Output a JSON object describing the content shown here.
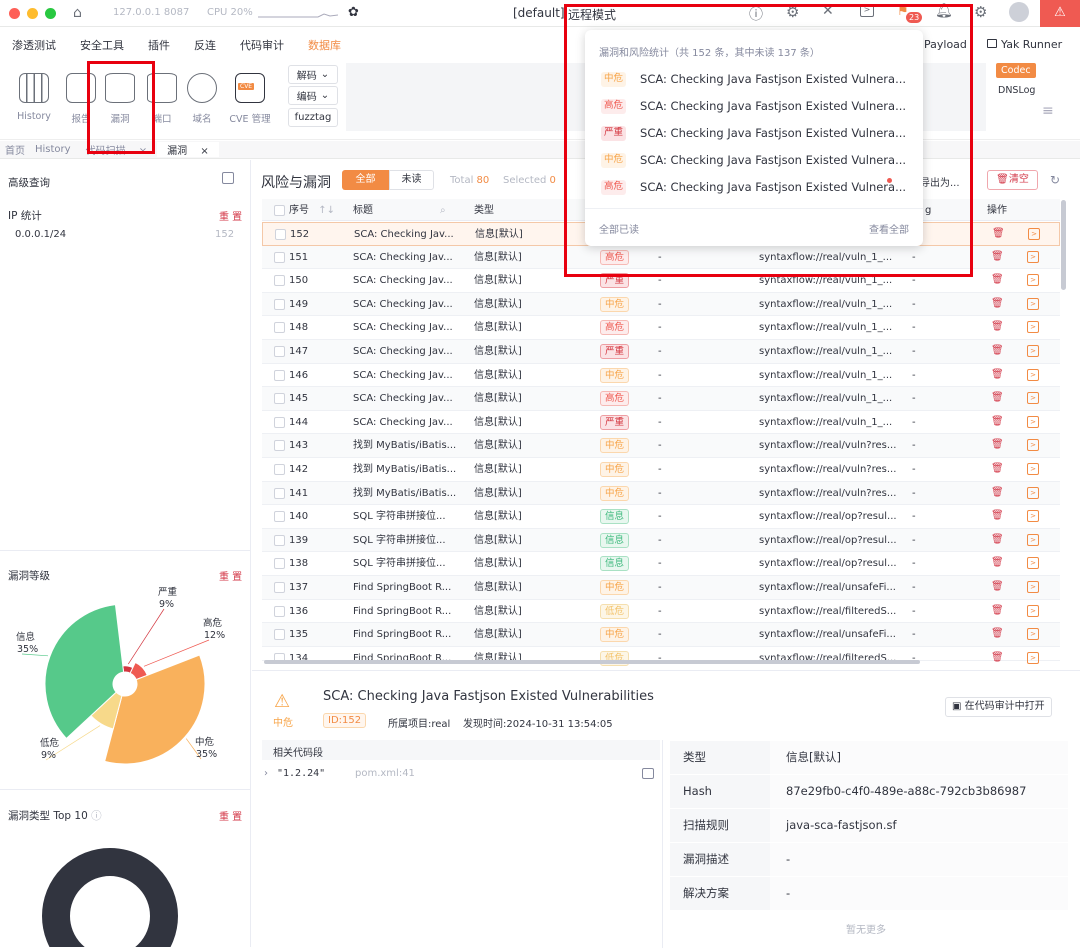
{
  "titlebar": {
    "host": "127.0.0.1 8087",
    "cpu": "CPU 20%",
    "project": "[default]",
    "mode": "远程模式",
    "notif_badge": "23"
  },
  "menu": [
    "渗透测试",
    "安全工具",
    "插件",
    "反连",
    "代码审计",
    "数据库"
  ],
  "menu_right": {
    "payload": "Payload",
    "yak_runner": "Yak Runner"
  },
  "toolbar": {
    "tools": [
      "History",
      "报告",
      "漏洞",
      "端口",
      "域名",
      "CVE 管理"
    ],
    "cve_badge": "CVE",
    "decode": "解码",
    "encode": "编码",
    "fuzztag": "fuzztag",
    "codec": "Codec",
    "dnslog": "DNSLog"
  },
  "tabs": [
    "首页",
    "History",
    "代码扫描",
    "漏洞"
  ],
  "sidebar": {
    "advanced_query": "高级查询",
    "ip_stats": "IP 统计",
    "reset": "重 置",
    "ip_rows": [
      {
        "ip": "0.0.0.1/24",
        "count": "152"
      }
    ],
    "level_title": "漏洞等级",
    "type_title": "漏洞类型 Top 10"
  },
  "chart_data": [
    {
      "type": "pie",
      "title": "漏洞等级",
      "labels": [
        "严重",
        "高危",
        "中危",
        "低危",
        "信息"
      ],
      "values": [
        9,
        12,
        35,
        9,
        35
      ],
      "display": [
        "9%",
        "12%",
        "35%",
        "9%",
        "35%"
      ],
      "colors": [
        "#d3363f",
        "#ef5a52",
        "#f9b15c",
        "#f7d98a",
        "#56c98a"
      ]
    },
    {
      "type": "pie",
      "title": "漏洞类型 Top 10",
      "labels": [],
      "values": [
        100
      ],
      "colors": [
        "#31343f"
      ]
    }
  ],
  "main": {
    "title": "风险与漏洞",
    "filter_all": "全部",
    "filter_unread": "未读",
    "total_label": "Total",
    "total": "80",
    "selected_label": "Selected",
    "selected": "0",
    "export": "导出为...",
    "clear": "清空",
    "columns": [
      "序号",
      "标题",
      "类型",
      "",
      "",
      "",
      "g",
      "操作"
    ],
    "rows": [
      {
        "id": "152",
        "title": "SCA: Checking Jav...",
        "type": "信息[默认]",
        "level": "",
        "lc": "",
        "ip": "",
        "path": "",
        "x": ""
      },
      {
        "id": "151",
        "title": "SCA: Checking Jav...",
        "type": "信息[默认]",
        "level": "高危",
        "lc": "t-high",
        "ip": "-",
        "path": "syntaxflow://real/vuln_1_...",
        "x": "-"
      },
      {
        "id": "150",
        "title": "SCA: Checking Jav...",
        "type": "信息[默认]",
        "level": "严重",
        "lc": "t-sev",
        "ip": "-",
        "path": "syntaxflow://real/vuln_1_...",
        "x": "-"
      },
      {
        "id": "149",
        "title": "SCA: Checking Jav...",
        "type": "信息[默认]",
        "level": "中危",
        "lc": "t-mid",
        "ip": "-",
        "path": "syntaxflow://real/vuln_1_...",
        "x": "-"
      },
      {
        "id": "148",
        "title": "SCA: Checking Jav...",
        "type": "信息[默认]",
        "level": "高危",
        "lc": "t-high",
        "ip": "-",
        "path": "syntaxflow://real/vuln_1_...",
        "x": "-"
      },
      {
        "id": "147",
        "title": "SCA: Checking Jav...",
        "type": "信息[默认]",
        "level": "严重",
        "lc": "t-sev",
        "ip": "-",
        "path": "syntaxflow://real/vuln_1_...",
        "x": "-"
      },
      {
        "id": "146",
        "title": "SCA: Checking Jav...",
        "type": "信息[默认]",
        "level": "中危",
        "lc": "t-mid",
        "ip": "-",
        "path": "syntaxflow://real/vuln_1_...",
        "x": "-"
      },
      {
        "id": "145",
        "title": "SCA: Checking Jav...",
        "type": "信息[默认]",
        "level": "高危",
        "lc": "t-high",
        "ip": "-",
        "path": "syntaxflow://real/vuln_1_...",
        "x": "-"
      },
      {
        "id": "144",
        "title": "SCA: Checking Jav...",
        "type": "信息[默认]",
        "level": "严重",
        "lc": "t-sev",
        "ip": "-",
        "path": "syntaxflow://real/vuln_1_...",
        "x": "-"
      },
      {
        "id": "143",
        "title": "找到 MyBatis/iBatis...",
        "type": "信息[默认]",
        "level": "中危",
        "lc": "t-mid",
        "ip": "-",
        "path": "syntaxflow://real/vuln?res...",
        "x": "-"
      },
      {
        "id": "142",
        "title": "找到 MyBatis/iBatis...",
        "type": "信息[默认]",
        "level": "中危",
        "lc": "t-mid",
        "ip": "-",
        "path": "syntaxflow://real/vuln?res...",
        "x": "-"
      },
      {
        "id": "141",
        "title": "找到 MyBatis/iBatis...",
        "type": "信息[默认]",
        "level": "中危",
        "lc": "t-mid",
        "ip": "-",
        "path": "syntaxflow://real/vuln?res...",
        "x": "-"
      },
      {
        "id": "140",
        "title": "SQL 字符串拼接位...",
        "type": "信息[默认]",
        "level": "信息",
        "lc": "t-info",
        "ip": "-",
        "path": "syntaxflow://real/op?resul...",
        "x": "-"
      },
      {
        "id": "139",
        "title": "SQL 字符串拼接位...",
        "type": "信息[默认]",
        "level": "信息",
        "lc": "t-info",
        "ip": "-",
        "path": "syntaxflow://real/op?resul...",
        "x": "-"
      },
      {
        "id": "138",
        "title": "SQL 字符串拼接位...",
        "type": "信息[默认]",
        "level": "信息",
        "lc": "t-info",
        "ip": "-",
        "path": "syntaxflow://real/op?resul...",
        "x": "-"
      },
      {
        "id": "137",
        "title": "Find SpringBoot R...",
        "type": "信息[默认]",
        "level": "中危",
        "lc": "t-mid",
        "ip": "-",
        "path": "syntaxflow://real/unsafeFi...",
        "x": "-"
      },
      {
        "id": "136",
        "title": "Find SpringBoot R...",
        "type": "信息[默认]",
        "level": "低危",
        "lc": "t-low",
        "ip": "-",
        "path": "syntaxflow://real/filteredS...",
        "x": "-"
      },
      {
        "id": "135",
        "title": "Find SpringBoot R...",
        "type": "信息[默认]",
        "level": "中危",
        "lc": "t-mid",
        "ip": "-",
        "path": "syntaxflow://real/unsafeFi...",
        "x": "-"
      },
      {
        "id": "134",
        "title": "Find SpringBoot R...",
        "type": "信息[默认]",
        "level": "低危",
        "lc": "t-low",
        "ip": "-",
        "path": "syntaxflow://real/filteredS...",
        "x": "-"
      }
    ]
  },
  "notifications": {
    "summary": "漏洞和风险统计（共 152 条，其中未读 137 条）",
    "items": [
      {
        "level": "中危",
        "lc": "t-mid",
        "text": "SCA: Checking Java Fastjson Existed Vulnera..."
      },
      {
        "level": "高危",
        "lc": "t-high",
        "text": "SCA: Checking Java Fastjson Existed Vulnera..."
      },
      {
        "level": "严重",
        "lc": "t-sev",
        "text": "SCA: Checking Java Fastjson Existed Vulnera..."
      },
      {
        "level": "中危",
        "lc": "t-mid",
        "text": "SCA: Checking Java Fastjson Existed Vulnera..."
      },
      {
        "level": "高危",
        "lc": "t-high",
        "text": "SCA: Checking Java Fastjson Existed Vulnera..."
      }
    ],
    "mark_all_read": "全部已读",
    "view_all": "查看全部"
  },
  "detail": {
    "level": "中危",
    "title": "SCA: Checking Java Fastjson Existed Vulnerabilities",
    "id": "ID:152",
    "project": "所属项目:real",
    "time": "发现时间:2024-10-31 13:54:05",
    "open_in_audit": "在代码审计中打开",
    "code_section": "相关代码段",
    "code_value": "\"1.2.24\"",
    "code_location": "pom.xml:41",
    "fields": [
      {
        "k": "类型",
        "v": "信息[默认]"
      },
      {
        "k": "Hash",
        "v": "87e29fb0-c4f0-489e-a88c-792cb3b86987"
      },
      {
        "k": "扫描规则",
        "v": "java-sca-fastjson.sf"
      },
      {
        "k": "漏洞描述",
        "v": "-"
      },
      {
        "k": "解决方案",
        "v": "-"
      }
    ],
    "no_more": "暂无更多"
  }
}
